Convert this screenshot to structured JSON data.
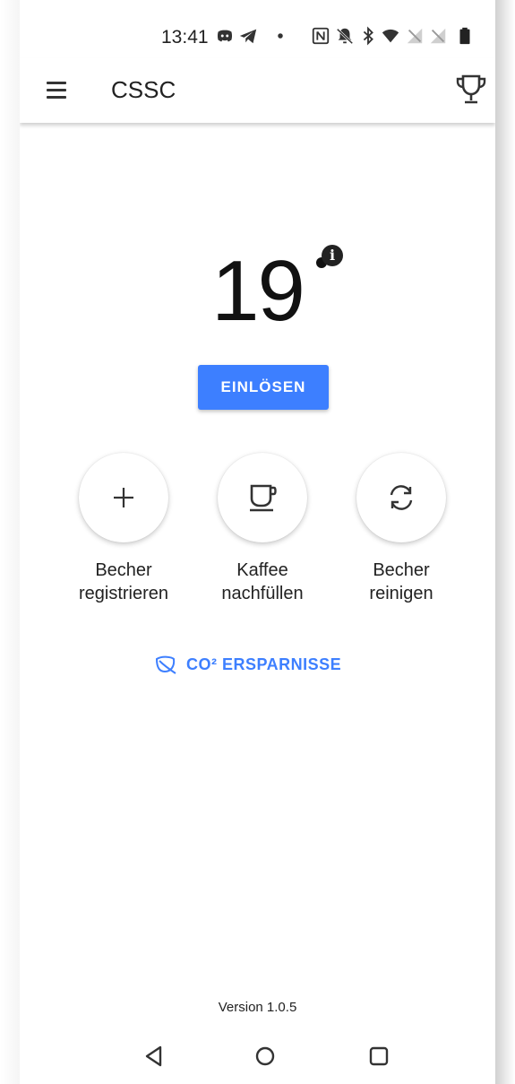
{
  "status_bar": {
    "time": "13:41",
    "icons": [
      "discord-icon",
      "telegram-icon",
      "dot-icon",
      "nfc-icon",
      "notifications-off-icon",
      "bluetooth-icon",
      "wifi-icon",
      "no-signal-icon",
      "no-signal-icon",
      "battery-icon"
    ]
  },
  "app_bar": {
    "title": "CSSC",
    "menu_icon": "hamburger-menu-icon",
    "trophy_icon": "trophy-icon"
  },
  "points": {
    "value": "19",
    "info_icon": "info-icon"
  },
  "redeem": {
    "label": "EINLÖSEN"
  },
  "actions": [
    {
      "label": "Becher registrieren",
      "line1": "Becher",
      "line2": "registrieren",
      "icon": "plus-icon"
    },
    {
      "label": "Kaffee nachfüllen",
      "line1": "Kaffee",
      "line2": "nachfüllen",
      "icon": "coffee-cup-icon"
    },
    {
      "label": "Becher reinigen",
      "line1": "Becher",
      "line2": "reinigen",
      "icon": "refresh-icon"
    }
  ],
  "co2": {
    "label": "CO² ERSPARNISSE",
    "icon": "leaf-icon"
  },
  "footer": {
    "version": "Version 1.0.5"
  },
  "nav_bar": {
    "icons": [
      "back-icon",
      "home-icon",
      "recents-icon"
    ]
  },
  "colors": {
    "accent": "#3d7fff"
  }
}
